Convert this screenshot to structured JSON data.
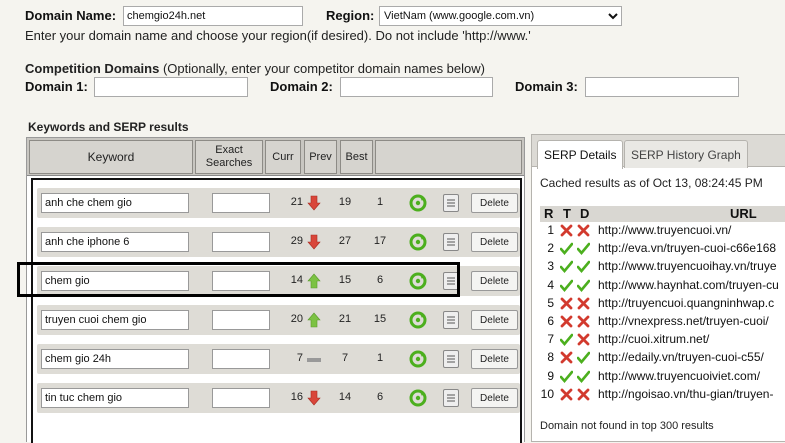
{
  "domain": {
    "label": "Domain Name:",
    "value": "chemgio24h.net",
    "region_label": "Region:",
    "region_value": "VietNam (www.google.com.vn)",
    "hint": "Enter your domain name and choose your region(if desired). Do not include 'http://www.'"
  },
  "competition": {
    "title": "Competition Domains",
    "subtitle": " (Optionally, enter your competitor domain names below)",
    "domain1_label": "Domain 1:",
    "domain2_label": "Domain 2:",
    "domain3_label": "Domain 3:"
  },
  "keywords_panel": {
    "title": "Keywords and SERP results",
    "headers": {
      "keyword": "Keyword",
      "exact": "Exact Searches",
      "curr": "Curr",
      "prev": "Prev",
      "best": "Best"
    },
    "delete_label": "Delete",
    "rows": [
      {
        "keyword": "anh che chem gio",
        "curr": "21",
        "trend": "down",
        "prev": "19",
        "best": "1"
      },
      {
        "keyword": "anh che iphone 6",
        "curr": "29",
        "trend": "down",
        "prev": "27",
        "best": "17"
      },
      {
        "keyword": "chem gio",
        "curr": "14",
        "trend": "up",
        "prev": "15",
        "best": "6"
      },
      {
        "keyword": "truyen cuoi chem gio",
        "curr": "20",
        "trend": "up",
        "prev": "21",
        "best": "15"
      },
      {
        "keyword": "chem gio 24h",
        "curr": "7",
        "trend": "same",
        "prev": "7",
        "best": "1"
      },
      {
        "keyword": "tin tuc chem gio",
        "curr": "16",
        "trend": "down",
        "prev": "14",
        "best": "6"
      }
    ]
  },
  "serp_panel": {
    "tabs": [
      "SERP Details",
      "SERP History Graph"
    ],
    "cached": "Cached results as of Oct 13, 08:24:45 PM",
    "headers": {
      "r": "R",
      "t": "T",
      "d": "D",
      "url": "URL"
    },
    "rows": [
      {
        "rank": "1",
        "t": "cross",
        "d": "cross",
        "url": "http://www.truyencuoi.vn/"
      },
      {
        "rank": "2",
        "t": "check",
        "d": "check",
        "url": "http://eva.vn/truyen-cuoi-c66e168"
      },
      {
        "rank": "3",
        "t": "check",
        "d": "check",
        "url": "http://www.truyencuoihay.vn/truye"
      },
      {
        "rank": "4",
        "t": "check",
        "d": "check",
        "url": "http://www.haynhat.com/truyen-cu"
      },
      {
        "rank": "5",
        "t": "cross",
        "d": "cross",
        "url": "http://truyencuoi.quangninhwap.c"
      },
      {
        "rank": "6",
        "t": "cross",
        "d": "cross",
        "url": "http://vnexpress.net/truyen-cuoi/"
      },
      {
        "rank": "7",
        "t": "check",
        "d": "cross",
        "url": "http://cuoi.xitrum.net/"
      },
      {
        "rank": "8",
        "t": "cross",
        "d": "check",
        "url": "http://edaily.vn/truyen-cuoi-c55/"
      },
      {
        "rank": "9",
        "t": "check",
        "d": "check",
        "url": "http://www.truyencuoiviet.com/"
      },
      {
        "rank": "10",
        "t": "cross",
        "d": "cross",
        "url": "http://ngoisao.vn/thu-gian/truyen-"
      }
    ],
    "not_found": "Domain not found in top 300 results"
  },
  "colors": {
    "arrow_down": "#d9463a",
    "arrow_up": "#7cc243",
    "same": "#999999",
    "refresh": "#4caf1e",
    "check": "#4caf1e",
    "cross": "#d23a2e"
  }
}
